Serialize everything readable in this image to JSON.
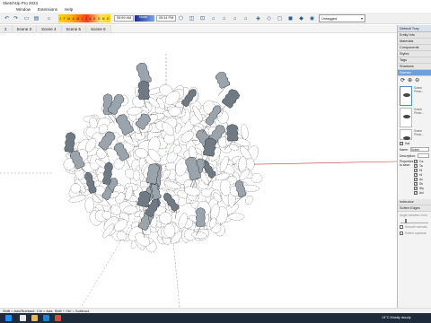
{
  "window": {
    "title": "SketchUp Pro 2023"
  },
  "menu": [
    "Window",
    "Extensions",
    "Help"
  ],
  "toolbar": {
    "months": [
      "J",
      "F",
      "M",
      "A",
      "M",
      "J",
      "J",
      "A",
      "S",
      "O",
      "N",
      "D"
    ],
    "time_start": "05:59 AM",
    "noon": "Noon",
    "time_end": "05:44 PM",
    "layer_value": "Untagged"
  },
  "scene_tabs": [
    "2",
    "Scene 3",
    "Scene 4",
    "Scene 5",
    "Scene 6"
  ],
  "tray": {
    "header": "Default Tray",
    "panels": [
      "Entity Info",
      "Materials",
      "Components",
      "Styles",
      "Tags",
      "Shadows",
      "Scenes"
    ],
    "scene_items": [
      {
        "name": "Scene",
        "desc": "Photo..."
      },
      {
        "name": "Scene",
        "desc": "Photo..."
      },
      {
        "name": "Scene",
        "desc": "Photo..."
      }
    ],
    "include_label": "Incl",
    "name_label": "Name:",
    "name_value": "Scene",
    "description_label": "Description:",
    "properties_label": "Properties to save:",
    "property_items": [
      "Ca",
      "Ta",
      "Hi",
      "Hi",
      "Ac",
      "Sh",
      "Sty",
      "Axi"
    ],
    "instructor": "Instructor",
    "soften_edges": "Soften Edges",
    "angle_label": "Angle between norm",
    "smooth_normals": "Smooth normals",
    "soften_coplanar": "Soften coplanar"
  },
  "status": "Shift = Add/Subtract, Ctrl = Add, Shift + Ctrl = Subtract.",
  "taskbar": {
    "weather": "13°C Mostly cloudy"
  },
  "colors": {
    "axis_red": "#c43a3a",
    "axis_green": "#3a9b3a",
    "tray_selected": "#6fa0d8"
  }
}
